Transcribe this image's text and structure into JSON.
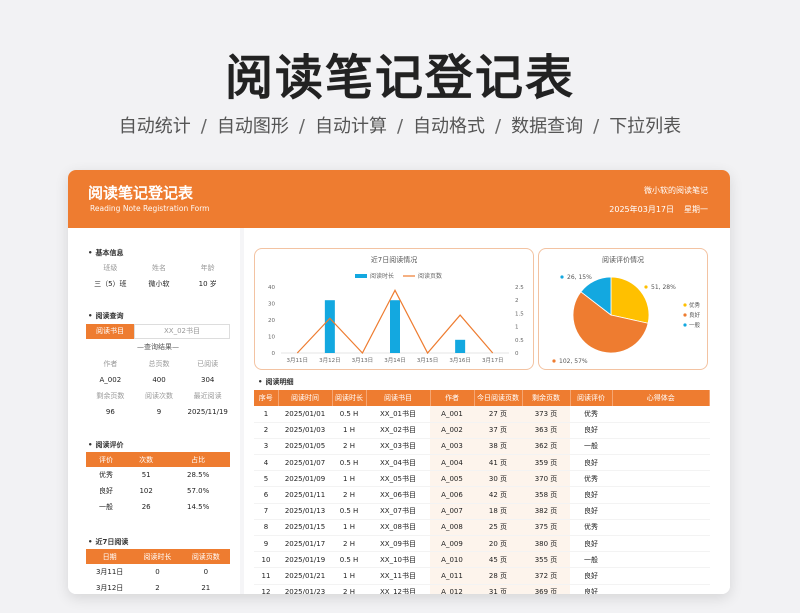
{
  "hero": {
    "title": "阅读笔记登记表",
    "features": [
      "自动统计",
      "自动图形",
      "自动计算",
      "自动格式",
      "数据查询",
      "下拉列表"
    ]
  },
  "header": {
    "title": "阅读笔记登记表",
    "subtitle": "Reading Note Registration Form",
    "brand": "微小软的阅读笔记",
    "date": "2025年03月17日",
    "weekday": "星期一"
  },
  "basic": {
    "section": "基本信息",
    "labels": [
      "班级",
      "姓名",
      "年龄"
    ],
    "values": [
      "三（5）班",
      "微小软",
      "10 岁"
    ]
  },
  "query": {
    "section": "阅读查询",
    "label": "阅读书目",
    "value": "XX_02书目",
    "result_label": "—查询结果—",
    "labels1": [
      "作者",
      "总页数",
      "已阅读"
    ],
    "values1": [
      "A_002",
      "400",
      "304"
    ],
    "labels2": [
      "剩余页数",
      "阅读次数",
      "最近阅读"
    ],
    "values2": [
      "96",
      "9",
      "2025/11/19"
    ]
  },
  "rating": {
    "section": "阅读评价",
    "headers": [
      "评价",
      "次数",
      "占比"
    ],
    "rows": [
      [
        "优秀",
        "51",
        "28.5%"
      ],
      [
        "良好",
        "102",
        "57.0%"
      ],
      [
        "一般",
        "26",
        "14.5%"
      ]
    ]
  },
  "recent": {
    "section": "近7日阅读",
    "headers": [
      "日期",
      "阅读时长",
      "阅读页数"
    ],
    "rows": [
      [
        "3月11日",
        "0",
        "0"
      ],
      [
        "3月12日",
        "2",
        "21"
      ]
    ]
  },
  "chart_data": [
    {
      "type": "bar",
      "title": "近7日阅读情况",
      "categories": [
        "3月11日",
        "3月12日",
        "3月13日",
        "3月14日",
        "3月15日",
        "3月16日",
        "3月17日"
      ],
      "series": [
        {
          "name": "阅读时长",
          "type": "bar",
          "axis": "right",
          "values": [
            0,
            2,
            0,
            2,
            0,
            0.5,
            0
          ],
          "color": "#13a8e0"
        },
        {
          "name": "阅读页数",
          "type": "line",
          "axis": "left",
          "values": [
            0,
            21,
            0,
            38,
            0,
            23,
            0
          ],
          "color": "#ee7c30"
        }
      ],
      "ylim_left": [
        0,
        40
      ],
      "yticks_left": [
        "0",
        "10",
        "20",
        "30",
        "40"
      ],
      "ylim_right": [
        0,
        2.5
      ],
      "yticks_right": [
        "0",
        "0.5",
        "1",
        "1.5",
        "2",
        "2.5"
      ]
    },
    {
      "type": "pie",
      "title": "阅读评价情况",
      "labels": [
        "优秀",
        "良好",
        "一般"
      ],
      "values": [
        51,
        102,
        26
      ],
      "percent_labels": [
        "51, 28%",
        "102, 57%",
        "26, 15%"
      ],
      "colors": [
        "#ffc000",
        "#ee7c30",
        "#13a8e0"
      ],
      "legend": "right"
    }
  ],
  "detail": {
    "section": "阅读明细",
    "headers": [
      "序号",
      "阅读时间",
      "阅读时长",
      "阅读书目",
      "作者",
      "今日阅读页数",
      "剩余页数",
      "阅读评价",
      "心得体会"
    ],
    "rows": [
      [
        "1",
        "2025/01/01",
        "0.5 H",
        "XX_01书目",
        "A_001",
        "27 页",
        "373 页",
        "优秀",
        ""
      ],
      [
        "2",
        "2025/01/03",
        "1 H",
        "XX_02书目",
        "A_002",
        "37 页",
        "363 页",
        "良好",
        ""
      ],
      [
        "3",
        "2025/01/05",
        "2 H",
        "XX_03书目",
        "A_003",
        "38 页",
        "362 页",
        "一般",
        ""
      ],
      [
        "4",
        "2025/01/07",
        "0.5 H",
        "XX_04书目",
        "A_004",
        "41 页",
        "359 页",
        "良好",
        ""
      ],
      [
        "5",
        "2025/01/09",
        "1 H",
        "XX_05书目",
        "A_005",
        "30 页",
        "370 页",
        "优秀",
        ""
      ],
      [
        "6",
        "2025/01/11",
        "2 H",
        "XX_06书目",
        "A_006",
        "42 页",
        "358 页",
        "良好",
        ""
      ],
      [
        "7",
        "2025/01/13",
        "0.5 H",
        "XX_07书目",
        "A_007",
        "18 页",
        "382 页",
        "良好",
        ""
      ],
      [
        "8",
        "2025/01/15",
        "1 H",
        "XX_08书目",
        "A_008",
        "25 页",
        "375 页",
        "优秀",
        ""
      ],
      [
        "9",
        "2025/01/17",
        "2 H",
        "XX_09书目",
        "A_009",
        "20 页",
        "380 页",
        "良好",
        ""
      ],
      [
        "10",
        "2025/01/19",
        "0.5 H",
        "XX_10书目",
        "A_010",
        "45 页",
        "355 页",
        "一般",
        ""
      ],
      [
        "11",
        "2025/01/21",
        "1 H",
        "XX_11书目",
        "A_011",
        "28 页",
        "372 页",
        "良好",
        ""
      ],
      [
        "12",
        "2025/01/23",
        "2 H",
        "XX_12书目",
        "A_012",
        "31 页",
        "369 页",
        "良好",
        ""
      ]
    ]
  }
}
